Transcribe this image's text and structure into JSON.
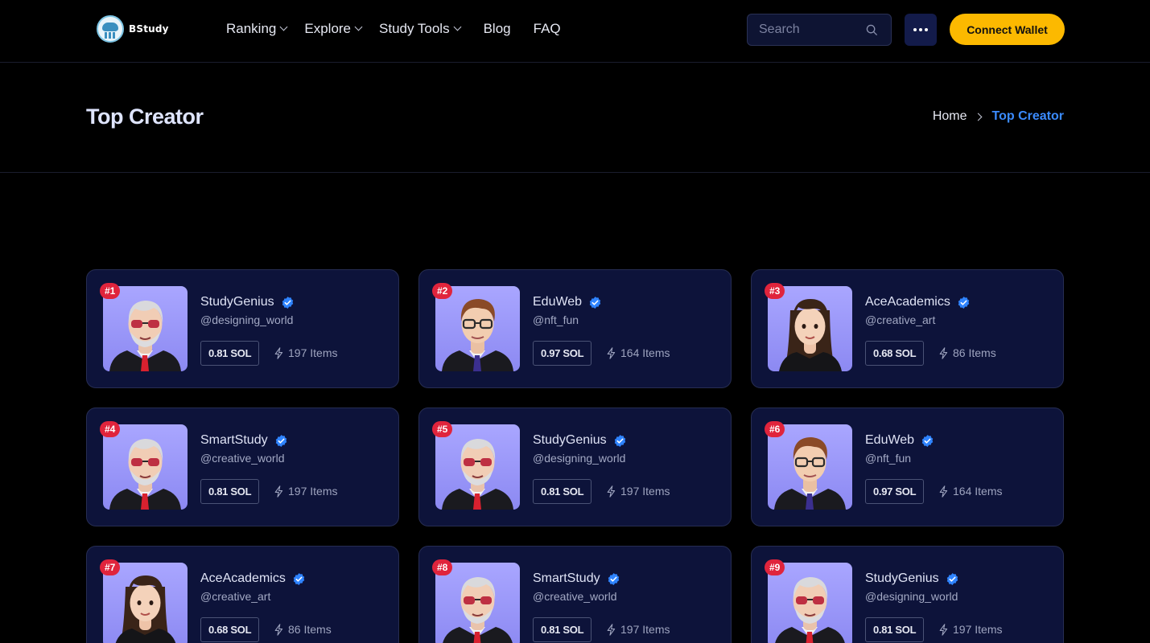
{
  "header": {
    "logo_text": "BStudy",
    "nav": [
      {
        "label": "Ranking",
        "dropdown": true
      },
      {
        "label": "Explore",
        "dropdown": true
      },
      {
        "label": "Study Tools",
        "dropdown": true
      },
      {
        "label": "Blog",
        "dropdown": false
      },
      {
        "label": "FAQ",
        "dropdown": false
      }
    ],
    "search_placeholder": "Search",
    "wallet_label": "Connect Wallet"
  },
  "page": {
    "title": "Top Creator",
    "breadcrumb": {
      "home": "Home",
      "current": "Top Creator"
    }
  },
  "colors": {
    "accent": "#3b8bff",
    "wallet": "#fcb900",
    "rank_badge": "#e0243c",
    "card_bg": "#0d133a"
  },
  "creators": [
    {
      "rank": "#1",
      "name": "StudyGenius",
      "handle": "@designing_world",
      "price": "0.81 SOL",
      "items": "197 Items",
      "avatar": "old-man-red-glasses"
    },
    {
      "rank": "#2",
      "name": "EduWeb",
      "handle": "@nft_fun",
      "price": "0.97 SOL",
      "items": "164 Items",
      "avatar": "young-man-brown-hair"
    },
    {
      "rank": "#3",
      "name": "AceAcademics",
      "handle": "@creative_art",
      "price": "0.68 SOL",
      "items": "86 Items",
      "avatar": "woman-dark-hair"
    },
    {
      "rank": "#4",
      "name": "SmartStudy",
      "handle": "@creative_world",
      "price": "0.81 SOL",
      "items": "197 Items",
      "avatar": "old-man-red-glasses"
    },
    {
      "rank": "#5",
      "name": "StudyGenius",
      "handle": "@designing_world",
      "price": "0.81 SOL",
      "items": "197 Items",
      "avatar": "old-man-red-glasses"
    },
    {
      "rank": "#6",
      "name": "EduWeb",
      "handle": "@nft_fun",
      "price": "0.97 SOL",
      "items": "164 Items",
      "avatar": "young-man-brown-hair"
    },
    {
      "rank": "#7",
      "name": "AceAcademics",
      "handle": "@creative_art",
      "price": "0.68 SOL",
      "items": "86 Items",
      "avatar": "woman-dark-hair"
    },
    {
      "rank": "#8",
      "name": "SmartStudy",
      "handle": "@creative_world",
      "price": "0.81 SOL",
      "items": "197 Items",
      "avatar": "old-man-red-glasses"
    },
    {
      "rank": "#9",
      "name": "StudyGenius",
      "handle": "@designing_world",
      "price": "0.81 SOL",
      "items": "197 Items",
      "avatar": "old-man-red-glasses"
    }
  ]
}
